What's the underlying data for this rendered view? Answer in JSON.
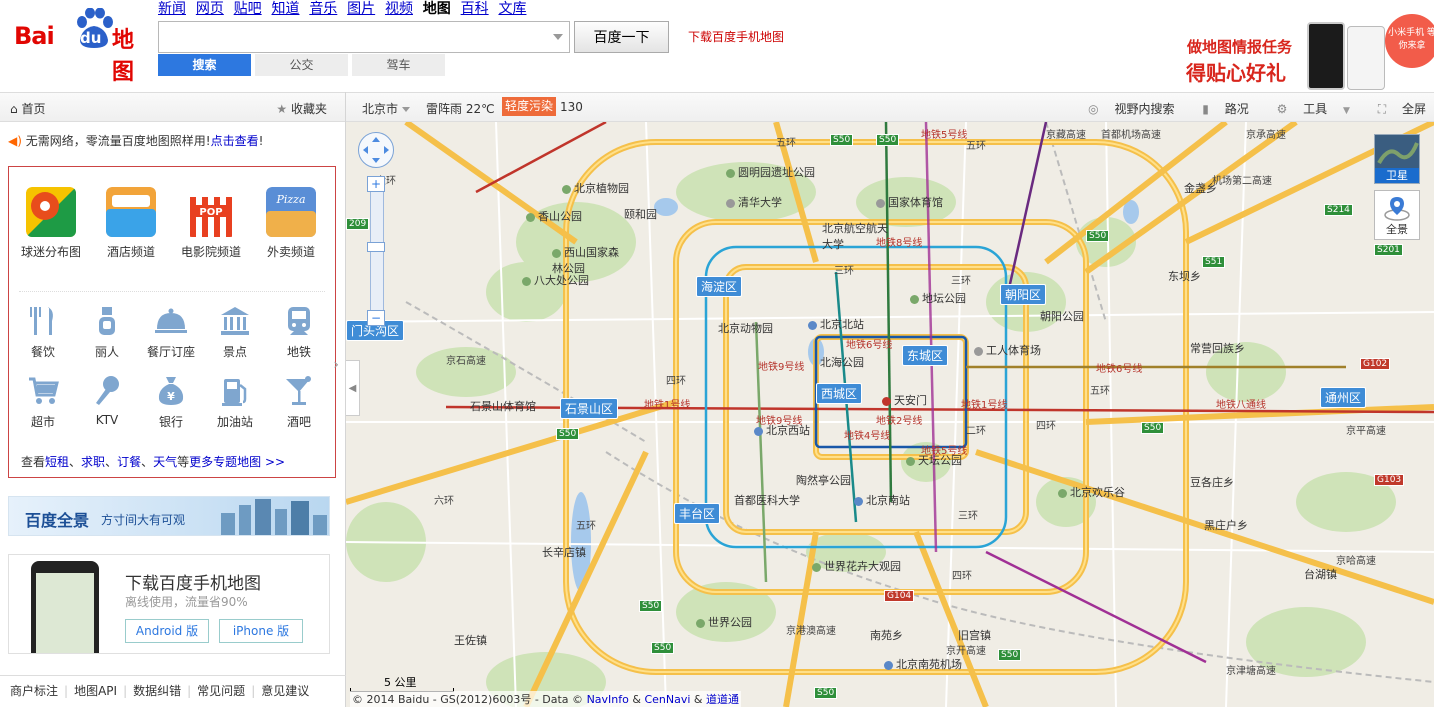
{
  "header": {
    "logo": {
      "bai": "Bai",
      "du": "du",
      "ditu": "地图"
    },
    "nav": [
      "新闻",
      "网页",
      "贴吧",
      "知道",
      "音乐",
      "图片",
      "视频",
      "地图",
      "百科",
      "文库"
    ],
    "nav_active": "地图",
    "search_placeholder": "",
    "search_button": "百度一下",
    "download_link": "下载百度手机地图",
    "mode_tabs": [
      "搜索",
      "公交",
      "驾车"
    ],
    "ad": {
      "line1": "做地图情报任务",
      "line2": "得贴心好礼",
      "bubble": "小米手机 等你来拿"
    }
  },
  "sidebar": {
    "home": "首页",
    "favorites": "收藏夹",
    "notice_text": "无需网络，零流量百度地图照样用!",
    "notice_link": "点击查看",
    "notice_end": "!",
    "big_topics": [
      {
        "label": "球迷分布图",
        "icon": "football-map-icon",
        "color": "#e84d1c"
      },
      {
        "label": "酒店频道",
        "icon": "hotel-icon",
        "color": "#3aa3e8"
      },
      {
        "label": "电影院频道",
        "icon": "cinema-icon",
        "color": "#e84020"
      },
      {
        "label": "外卖频道",
        "icon": "pizza-icon",
        "color": "#5a8ed6"
      }
    ],
    "small_topics": [
      {
        "label": "餐饮",
        "icon": "fork-knife-icon"
      },
      {
        "label": "丽人",
        "icon": "beauty-icon"
      },
      {
        "label": "餐厅订座",
        "icon": "cloche-icon"
      },
      {
        "label": "景点",
        "icon": "landmark-icon"
      },
      {
        "label": "地铁",
        "icon": "subway-icon"
      },
      {
        "label": "超市",
        "icon": "cart-icon"
      },
      {
        "label": "KTV",
        "icon": "microphone-icon"
      },
      {
        "label": "银行",
        "icon": "money-bag-icon"
      },
      {
        "label": "加油站",
        "icon": "gas-station-icon"
      },
      {
        "label": "酒吧",
        "icon": "cocktail-icon"
      }
    ],
    "more": {
      "prefix": "查看",
      "links": [
        "短租",
        "求职",
        "订餐",
        "天气"
      ],
      "mid": "等",
      "more_link": "更多专题地图 >>"
    },
    "pano_banner": {
      "title": "百度全景",
      "subtitle": "方寸间大有可观"
    },
    "mobile": {
      "title": "下载百度手机地图",
      "subtitle": "离线使用，流量省90%",
      "android": "Android 版",
      "iphone": "iPhone 版"
    },
    "footer": [
      "商户标注",
      "地图API",
      "数据纠错",
      "常见问题",
      "意见建议"
    ]
  },
  "map_bar": {
    "city": "北京市",
    "weather": "雷阵雨 22℃",
    "aqi_label": "轻度污染",
    "aqi_value": "130",
    "tools": [
      "视野内搜索",
      "路况",
      "工具",
      "全屏"
    ]
  },
  "map": {
    "districts": [
      {
        "name": "海淀区"
      },
      {
        "name": "朝阳区"
      },
      {
        "name": "东城区"
      },
      {
        "name": "西城区"
      },
      {
        "name": "石景山区"
      },
      {
        "name": "丰台区"
      },
      {
        "name": "通州区"
      },
      {
        "name": "门头沟区"
      }
    ],
    "places": [
      "北京植物园",
      "圆明园遗址公园",
      "清华大学",
      "颐和园",
      "香山公园",
      "北京航空航天大学",
      "国家体育馆",
      "西山国家森林公园",
      "八大处公园",
      "北京动物园",
      "北京北站",
      "地坛公园",
      "北海公园",
      "工人体育场",
      "朝阳公园",
      "天安门",
      "石景山体育馆",
      "北京西站",
      "天坛公园",
      "陶然亭公园",
      "首都医科大学",
      "北京南站",
      "北京欢乐谷",
      "世界花卉大观园",
      "世界公园",
      "南苑乡",
      "旧宫镇",
      "北京南苑机场",
      "长辛店镇",
      "王佐镇",
      "金盏乡",
      "东坝乡",
      "常营回族乡",
      "豆各庄乡",
      "黑庄户乡",
      "台湖镇"
    ],
    "highways": [
      "S50",
      "S50",
      "S50",
      "S50",
      "S50",
      "S50",
      "S50",
      "S50",
      "S50",
      "S214",
      "S201",
      "S51",
      "G102",
      "G103",
      "G104",
      "209"
    ],
    "rings": [
      "五环",
      "四环",
      "三环",
      "二环",
      "三环",
      "四环",
      "五环",
      "六环",
      "五环",
      "四环",
      "三环",
      "六环",
      "五环"
    ],
    "subway_labels": [
      "地铁1号线",
      "地铁1号线",
      "地铁八通线",
      "地铁6号线",
      "地铁6号线",
      "地铁2号线",
      "地铁4号线",
      "地铁9号线",
      "地铁8号线",
      "地铁5号线",
      "地铁5号线",
      "地铁9号线"
    ],
    "expressways": [
      "京藏高速",
      "首都机场高速",
      "机场第二高速",
      "京哈高速",
      "京开高速",
      "京港澳高速",
      "京石高速",
      "京承高速",
      "京平高速",
      "京津塘高速"
    ],
    "controls": {
      "satellite": "卫星",
      "panorama": "全景"
    },
    "scale": "5 公里",
    "copyright": {
      "prefix": "© 2014 Baidu - GS(2012)6003号 - Data ©",
      "navinfo": "NavInfo",
      "and": "&",
      "cennavi": "CenNavi",
      "and2": "&",
      "daodao": "道道通"
    }
  }
}
